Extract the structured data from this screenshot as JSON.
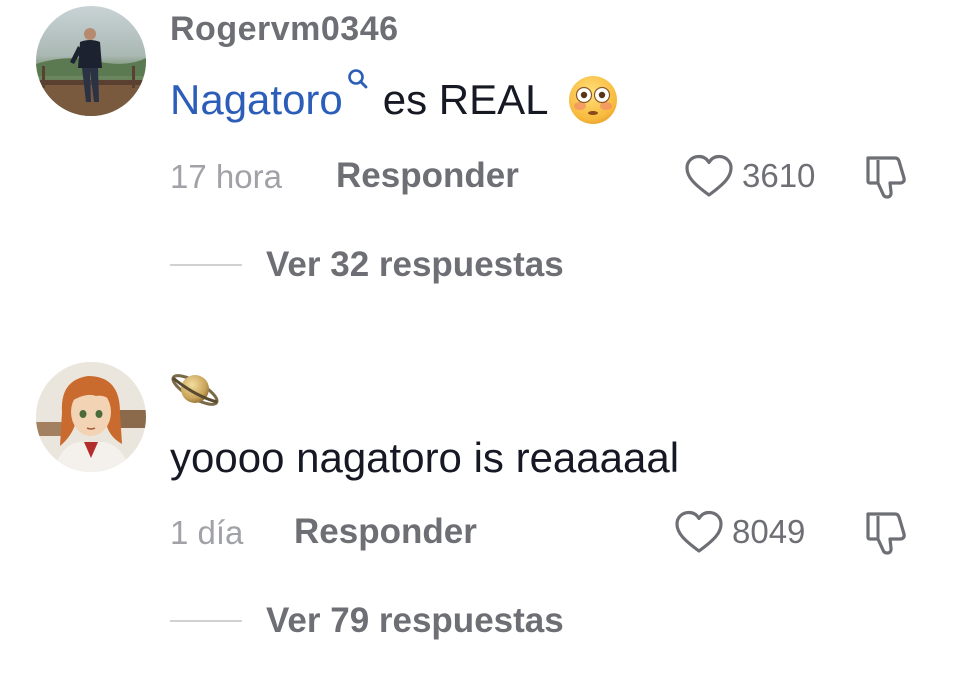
{
  "comments": [
    {
      "username": "Rogervm0346",
      "mention": "Nagatoro",
      "text": "es REAL",
      "emoji_icon": "flushed-face-icon",
      "time": "17 hora",
      "reply_label": "Responder",
      "likes": "3610",
      "view_replies": "Ver 32 respuestas"
    },
    {
      "username_icon": "ringed-planet-icon",
      "text": "yoooo nagatoro is reaaaaal",
      "time": "1 día",
      "reply_label": "Responder",
      "likes": "8049",
      "view_replies": "Ver 79 respuestas"
    }
  ],
  "colors": {
    "mention": "#2b5db9",
    "text": "#161823",
    "secondary": "#6e6f75",
    "muted": "#a1a2a7"
  }
}
